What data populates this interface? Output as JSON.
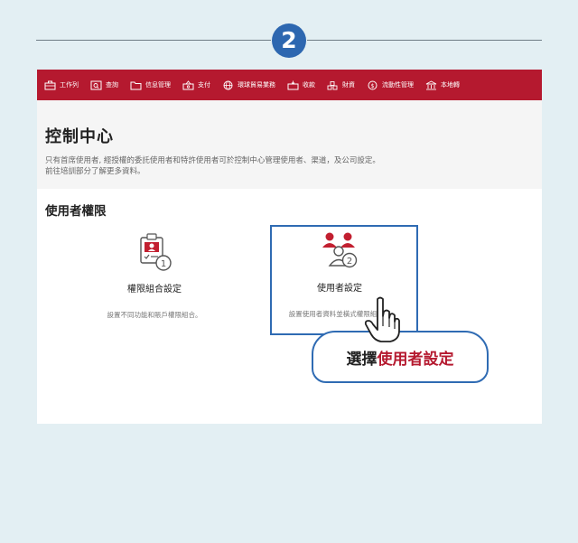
{
  "step": {
    "number": "2"
  },
  "nav": {
    "items": [
      {
        "label": "工作列",
        "icon": "briefcase-icon"
      },
      {
        "label": "查詢",
        "icon": "search-doc-icon"
      },
      {
        "label": "信息管理",
        "icon": "folder-icon"
      },
      {
        "label": "支付",
        "icon": "payment-icon"
      },
      {
        "label": "環球貿易業務",
        "icon": "globe-icon"
      },
      {
        "label": "收款",
        "icon": "receive-icon"
      },
      {
        "label": "財資",
        "icon": "treasury-icon"
      },
      {
        "label": "流動性管理",
        "icon": "liquidity-icon"
      },
      {
        "label": "本地轉",
        "icon": "bank-icon"
      }
    ]
  },
  "header": {
    "title": "控制中心",
    "desc_line1": "只有首席使用者, 經授權的委託使用者和特許使用者可於控制中心管理使用者、渠道，及公司設定。",
    "desc_line2": "前往培訓部分了解更多資料。"
  },
  "section": {
    "title": "使用者權限"
  },
  "cards": [
    {
      "title": "權限組合設定",
      "desc": "設置不同功能和賬戶權限組合。"
    },
    {
      "title": "使用者設定",
      "desc": "設置使用者資料並橫式權限組合。"
    }
  ],
  "callout": {
    "prefix": "選擇",
    "highlight": "使用者設定"
  },
  "colors": {
    "brand_red": "#b5192f",
    "accent_blue": "#2f6bb3",
    "background": "#e3eff3"
  }
}
